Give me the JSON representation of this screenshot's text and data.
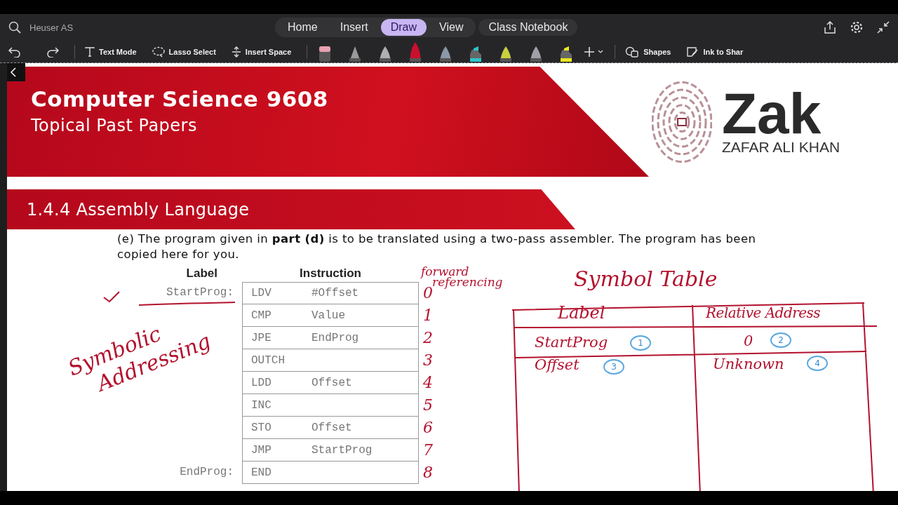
{
  "app": {
    "search": "Heuser AS",
    "tabs": [
      {
        "label": "Home",
        "selected": false
      },
      {
        "label": "Insert",
        "selected": false
      },
      {
        "label": "Draw",
        "selected": true
      },
      {
        "label": "View",
        "selected": false
      }
    ],
    "extra_tab": "Class Notebook",
    "tools": [
      {
        "kind": "text",
        "label": "Text Mode"
      },
      {
        "kind": "lasso",
        "label": "Lasso Select"
      },
      {
        "kind": "space",
        "label": "Insert Space"
      }
    ],
    "pens": [
      {
        "kind": "eraser",
        "color": "#e8a0b0",
        "selected": false
      },
      {
        "kind": "pencil",
        "color": "#9a9a9a",
        "selected": false
      },
      {
        "kind": "pen",
        "color": "#b0b0b0",
        "selected": false
      },
      {
        "kind": "pen",
        "color": "#c8102e",
        "selected": true
      },
      {
        "kind": "pen",
        "color": "#8a98a8",
        "selected": false
      },
      {
        "kind": "highlighter",
        "color": "#2ec4c8",
        "selected": false
      },
      {
        "kind": "pen",
        "color": "#c8d040",
        "selected": false
      },
      {
        "kind": "pen",
        "color": "#a0a0a8",
        "selected": false
      },
      {
        "kind": "highlighter",
        "color": "#e8e820",
        "selected": false
      }
    ],
    "more_tools": [
      {
        "kind": "shapes",
        "label": "Shapes"
      },
      {
        "kind": "ink",
        "label": "Ink to Shar"
      }
    ]
  },
  "document": {
    "title": "Computer Science 9608",
    "subtitle": "Topical Past Papers",
    "logo": {
      "name": "Zak",
      "tagline": "ZAFAR ALI KHAN"
    },
    "section": "1.4.4 Assembly Language",
    "question": "(e) The program given in **part (d)** is to be translated using a two-pass assembler. The program has been copied here for you.",
    "program": {
      "headers": [
        "Label",
        "Instruction"
      ],
      "rows": [
        {
          "label": "StartProg:",
          "opcode": "LDV",
          "operand": "#Offset"
        },
        {
          "label": "",
          "opcode": "CMP",
          "operand": "Value"
        },
        {
          "label": "",
          "opcode": "JPE",
          "operand": "EndProg"
        },
        {
          "label": "",
          "opcode": "OUTCH",
          "operand": ""
        },
        {
          "label": "",
          "opcode": "LDD",
          "operand": "Offset"
        },
        {
          "label": "",
          "opcode": "INC",
          "operand": ""
        },
        {
          "label": "",
          "opcode": "STO",
          "operand": "Offset"
        },
        {
          "label": "",
          "opcode": "JMP",
          "operand": "StartProg"
        },
        {
          "label": "EndProg:",
          "opcode": "END",
          "operand": ""
        }
      ]
    }
  },
  "ink": {
    "line_numbers": [
      "0",
      "1",
      "2",
      "3",
      "4",
      "5",
      "6",
      "7",
      "8"
    ],
    "forward_note": [
      "forward",
      "referencing"
    ],
    "symbolic_note": [
      "Symbolic",
      "Addressing"
    ],
    "symbol_table": {
      "title": "Symbol Table",
      "columns": [
        "Label",
        "Relative Address"
      ],
      "rows": [
        {
          "label": "StartProg",
          "label_step": "1",
          "address": "0",
          "address_step": "2"
        },
        {
          "label": "Offset",
          "label_step": "3",
          "address": "Unknown",
          "address_step": "4"
        }
      ]
    }
  }
}
